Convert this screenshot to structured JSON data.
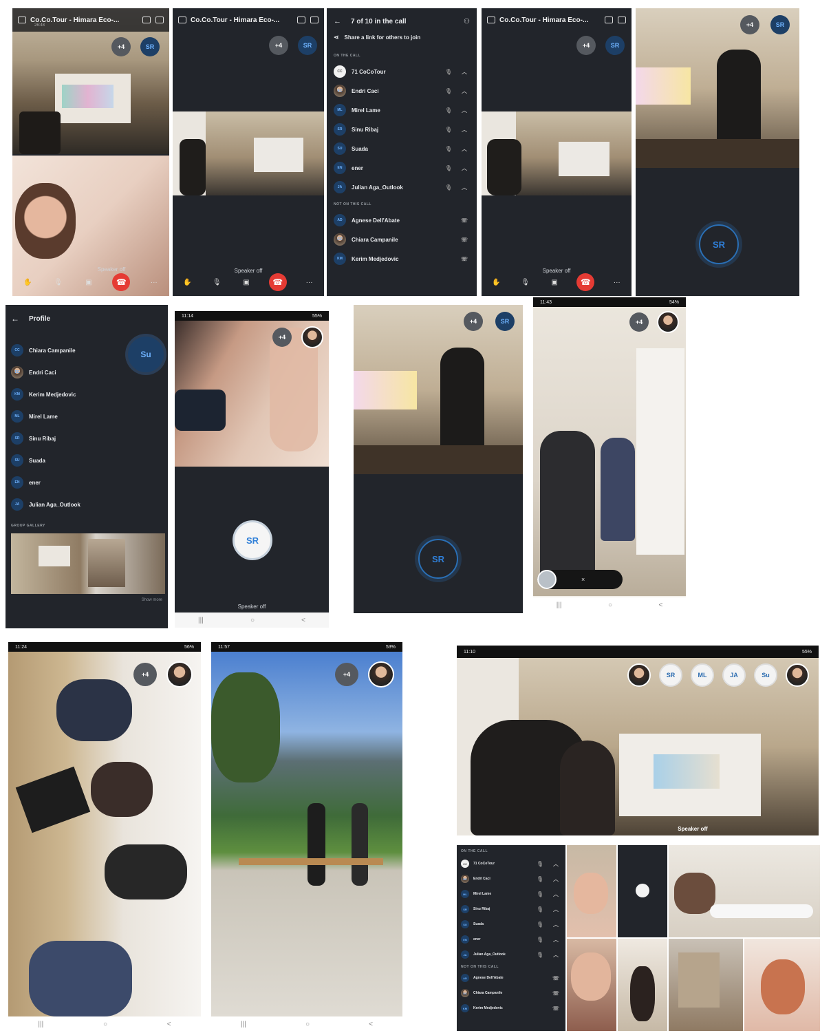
{
  "call": {
    "title": "Co.Co.Tour - Himara Eco-...",
    "sub": "26:48",
    "more_count": "+4",
    "self_initials": "SR",
    "speaker_label": "Speaker off",
    "speaker_label_variant": "Speaker off",
    "dots": "···"
  },
  "participants_panel": {
    "header": "7 of 10 in the call",
    "share_link": "Share a link for others to join",
    "on_call_header": "ON THE CALL",
    "not_on_call_header": "NOT ON THIS CALL",
    "on_call": [
      {
        "name": "71 CoCoTour",
        "initials": "CC"
      },
      {
        "name": "Endri Caci",
        "initials": "EC"
      },
      {
        "name": "Mirel Lame",
        "initials": "ML"
      },
      {
        "name": "Sinu Ribaj",
        "initials": "SR"
      },
      {
        "name": "Suada",
        "initials": "SU"
      },
      {
        "name": "ener",
        "initials": "EN"
      },
      {
        "name": "Julian Aga_Outlook",
        "initials": "JA"
      }
    ],
    "not_on_call": [
      {
        "name": "Agnese Dell'Abate",
        "initials": "AD"
      },
      {
        "name": "Chiara Campanile",
        "initials": "CC"
      },
      {
        "name": "Kerim Medjedovic",
        "initials": "KM"
      }
    ]
  },
  "profile_panel": {
    "title": "Profile",
    "members": [
      {
        "name": "Chiara Campanile",
        "initials": "CC"
      },
      {
        "name": "Endri Caci",
        "initials": "EC"
      },
      {
        "name": "Kerim Medjedovic",
        "initials": "KM"
      },
      {
        "name": "Mirel Lame",
        "initials": "ML"
      },
      {
        "name": "Sinu Ribaj",
        "initials": "SR"
      },
      {
        "name": "Suada",
        "initials": "SU"
      },
      {
        "name": "ener",
        "initials": "EN"
      },
      {
        "name": "Julian Aga_Outlook",
        "initials": "JA"
      }
    ],
    "gallery_header": "GROUP GALLERY",
    "show_more": "Show more",
    "bubble_initials": "Su"
  },
  "phone": {
    "time_a": "11:14",
    "time_b": "11:43",
    "time_c": "11:24",
    "time_d": "11:57",
    "time_e": "11:10",
    "battery_a": "55%",
    "battery_b": "54%",
    "battery_c": "56%",
    "battery_d": "53%",
    "battery_e": "55%",
    "nav_recent": "|||",
    "nav_home": "○",
    "nav_back": "<"
  },
  "top_strip": [
    "SR",
    "ML",
    "JA",
    "Su"
  ],
  "colors": {
    "panel": "#22252b",
    "hangup": "#e53b34",
    "accent": "#2f7fd8"
  }
}
